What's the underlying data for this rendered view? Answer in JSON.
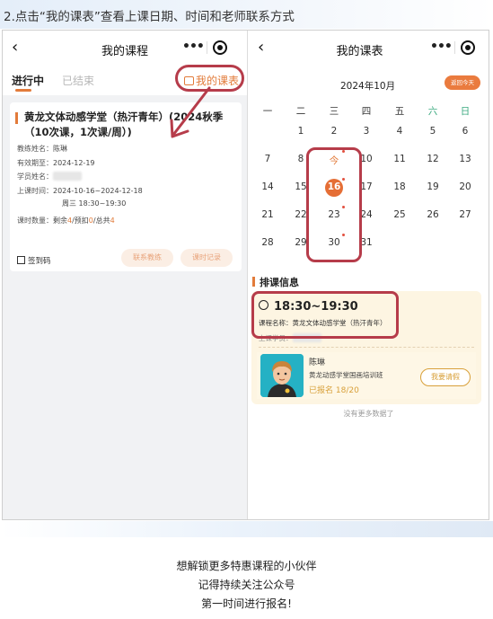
{
  "heading": "2.点击“我的课表”查看上课日期、时间和老师联系方式",
  "left": {
    "nav": {
      "back": "‹",
      "title": "我的课程"
    },
    "tabs": {
      "active": "进行中",
      "inactive": "已结束",
      "link": "我的课表"
    },
    "card": {
      "title": "黄龙文体动感学堂（热汗青年）(2024秋季（10次课，1次课/周）)",
      "teacher_label": "教练姓名：",
      "teacher": "陈琳",
      "valid_label": "有效期至：",
      "valid": "2024-12-19",
      "student_label": "学员姓名：",
      "time_label": "上课时间：",
      "time1": "2024-10-16~2024-12-18",
      "time2": "周三 18:30~19:30",
      "count_label": "课时数量：",
      "count_parts": [
        "剩余",
        "4",
        "/预扣",
        "0",
        "/总共",
        "4"
      ],
      "signcode": "签到码",
      "contact_btn": "联系教练",
      "record_btn": "课时记录"
    }
  },
  "right": {
    "nav": {
      "back": "‹",
      "title": "我的课表"
    },
    "month": "2024年10月",
    "today_btn": "返回今天",
    "weekdays": [
      "一",
      "二",
      "三",
      "四",
      "五",
      "六",
      "日"
    ],
    "weeks": [
      [
        "",
        "1",
        "2",
        "3",
        "4",
        "5",
        "6"
      ],
      [
        "7",
        "8",
        "今",
        "10",
        "11",
        "12",
        "13"
      ],
      [
        "14",
        "15",
        "16",
        "17",
        "18",
        "19",
        "20"
      ],
      [
        "21",
        "22",
        "23",
        "24",
        "25",
        "26",
        "27"
      ],
      [
        "28",
        "29",
        "30",
        "31",
        "",
        "",
        ""
      ]
    ],
    "section_title": "排课信息",
    "schedule": {
      "time": "18:30~19:30",
      "course": "课程名称：黄龙文体动感学堂（热汗青年）",
      "student_label": "上课学员：",
      "teacher": "陈琳",
      "org": "黄龙动感学堂国画培训班",
      "signed": "已报名 18/20",
      "ask_btn": "我要请假"
    },
    "no_more": "没有更多数据了"
  },
  "promo": {
    "line1": "想解锁更多特惠课程的小伙伴",
    "line2": "记得持续关注公众号",
    "line3": "第一时间进行报名!"
  },
  "colors": {
    "accent": "#e27b3a",
    "highlight": "#b63c4a",
    "gold": "#d8a03a"
  }
}
